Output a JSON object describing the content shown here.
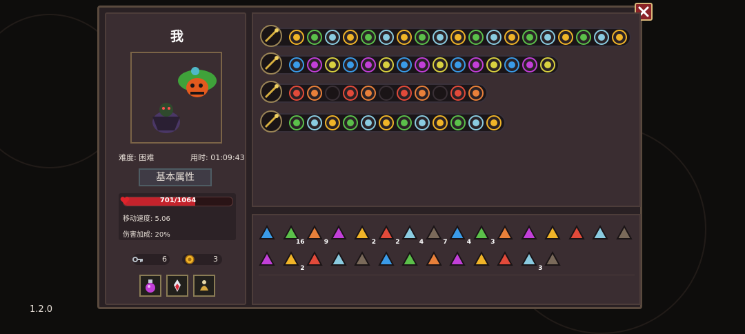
{
  "character": {
    "name": "我",
    "difficulty_label": "难度: 困难",
    "time_label": "用时: 01:09:43"
  },
  "attributes": {
    "button_label": "基本属性",
    "hp": "701/1064",
    "hp_fraction": 0.659,
    "move_speed": "移动速度: 5.06",
    "damage_bonus": "伤害加成: 20%"
  },
  "resources": {
    "keys": "6",
    "coins": "3"
  },
  "potions": [
    {
      "icon": "purple-potion-icon"
    },
    {
      "icon": "red-crystal-icon"
    },
    {
      "icon": "gold-bell-icon"
    }
  ],
  "weapons": [
    {
      "icon": "treasure-chest-icon",
      "slots": 19
    },
    {
      "icon": "golden-spear-icon",
      "slots": 15
    },
    {
      "icon": "ornate-staff-icon",
      "slots": 11
    },
    {
      "icon": "long-spear-icon",
      "slots": 12
    }
  ],
  "items": {
    "row1": [
      {
        "icon": "green-octopus-icon",
        "count": ""
      },
      {
        "icon": "green-arrow-icon",
        "count": "16"
      },
      {
        "icon": "teal-arrow-icon",
        "count": "9"
      },
      {
        "icon": "green-plant-icon",
        "count": ""
      },
      {
        "icon": "plus-arrow-icon",
        "count": "2"
      },
      {
        "icon": "red-demon-icon",
        "count": "2"
      },
      {
        "icon": "purple-box-icon",
        "count": "4"
      },
      {
        "icon": "orange-bow-icon",
        "count": "7"
      },
      {
        "icon": "teal-crossbow-icon",
        "count": "4"
      },
      {
        "icon": "spiral-arrow-icon",
        "count": "3"
      },
      {
        "icon": "green-leaf-icon",
        "count": ""
      },
      {
        "icon": "pink-egg-icon",
        "count": ""
      },
      {
        "icon": "witch-hat-icon",
        "count": ""
      },
      {
        "icon": "dark-helmet-icon",
        "count": ""
      },
      {
        "icon": "stone-golem-icon",
        "count": ""
      },
      {
        "icon": "gold-key-icon",
        "count": ""
      }
    ],
    "row2": [
      {
        "icon": "pink-pig-icon",
        "count": ""
      },
      {
        "icon": "gold-antler-icon",
        "count": "2"
      },
      {
        "icon": "green-syringe-icon",
        "count": ""
      },
      {
        "icon": "shadow-face-icon",
        "count": ""
      },
      {
        "icon": "gold-crystal-icon",
        "count": ""
      },
      {
        "icon": "purple-shield-icon",
        "count": ""
      },
      {
        "icon": "orange-heart-icon",
        "count": ""
      },
      {
        "icon": "dark-spider-icon",
        "count": ""
      },
      {
        "icon": "orange-scroll-icon",
        "count": ""
      },
      {
        "icon": "green-ufo-icon",
        "count": ""
      },
      {
        "icon": "dark-robe-icon",
        "count": ""
      },
      {
        "icon": "green-arrows-icon",
        "count": "3"
      },
      {
        "icon": "dark-gem-icon",
        "count": ""
      }
    ]
  },
  "version": "1.2.0"
}
